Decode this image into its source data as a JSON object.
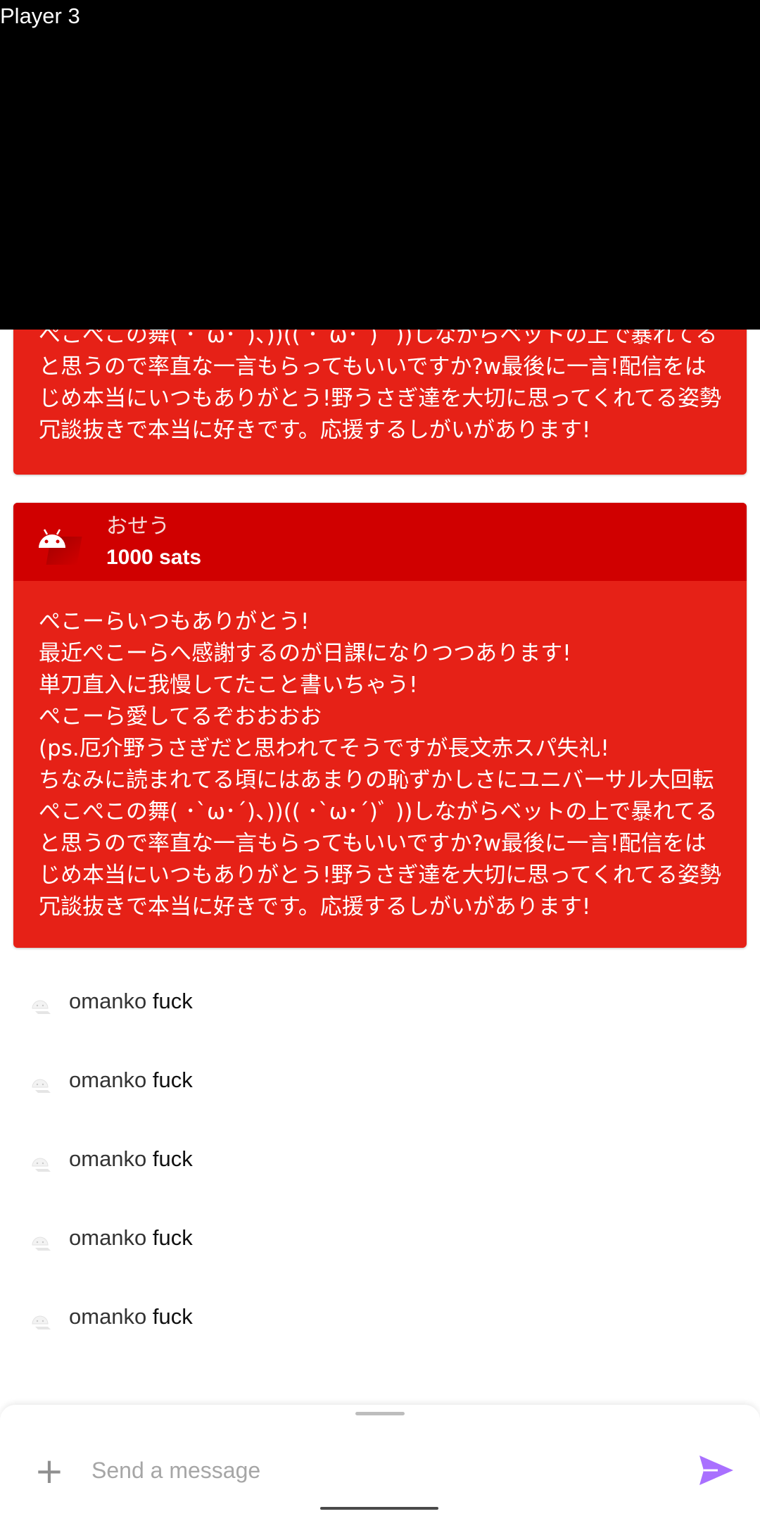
{
  "player": {
    "label": "Player 3"
  },
  "superchats": [
    {
      "message_tail": "ぺこぺこの舞( ･`ω･´)、))(( ･`ω･´)ﾞ ))しながらベットの上で暴れてると思うので率直な一言もらってもいいですか?w最後に一言!配信をはじめ本当にいつもありがとう!野うさぎ達を大切に思ってくれてる姿勢冗談抜きで本当に好きです。応援するしがいがあります!"
    },
    {
      "author": "おせう",
      "amount": "1000 sats",
      "avatar_icon": "android-icon",
      "message": "ぺこーらいつもありがとう!\n最近ぺこーらへ感謝するのが日課になりつつあります!\n単刀直入に我慢してたこと書いちゃう!\nぺこーら愛してるぞおおおお\n(ps.厄介野うさぎだと思われてそうですが長文赤スパ失礼!\nちなみに読まれてる頃にはあまりの恥ずかしさにユニバーサル大回転ぺこぺこの舞( ･`ω･´)、))(( ･`ω･´)ﾞ ))しながらベットの上で暴れてると思うので率直な一言もらってもいいですか?w最後に一言!配信をはじめ本当にいつもありがとう!野うさぎ達を大切に思ってくれてる姿勢冗談抜きで本当に好きです。応援するしがいがあります!"
    }
  ],
  "chat": [
    {
      "author": "omanko",
      "message": "fuck",
      "avatar_icon": "android-icon"
    },
    {
      "author": "omanko",
      "message": "fuck",
      "avatar_icon": "android-icon"
    },
    {
      "author": "omanko",
      "message": "fuck",
      "avatar_icon": "android-icon"
    },
    {
      "author": "omanko",
      "message": "fuck",
      "avatar_icon": "android-icon"
    },
    {
      "author": "omanko",
      "message": "fuck",
      "avatar_icon": "android-icon"
    }
  ],
  "composer": {
    "placeholder": "Send a message",
    "add_icon": "plus-icon",
    "send_icon": "send-icon"
  },
  "colors": {
    "superchat_body": "#e62117",
    "superchat_header": "#d00000",
    "send_accent": "#a970ff"
  }
}
